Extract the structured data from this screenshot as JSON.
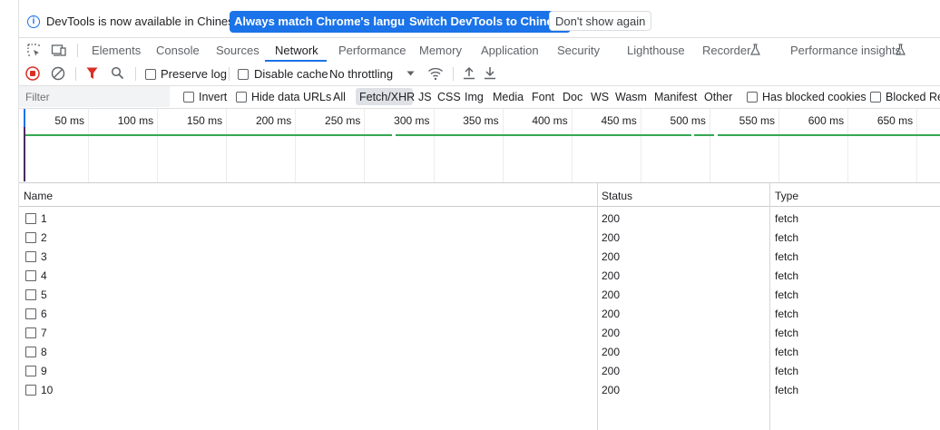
{
  "infobar": {
    "message": "DevTools is now available in Chinese!",
    "match_button": "Always match Chrome's language",
    "switch_button": "Switch DevTools to Chinese",
    "dismiss_button": "Don't show again"
  },
  "tabs": [
    "Elements",
    "Console",
    "Sources",
    "Network",
    "Performance",
    "Memory",
    "Application",
    "Security",
    "Lighthouse",
    "Recorder",
    "Performance insights"
  ],
  "active_tab": "Network",
  "toolbar": {
    "preserve_log": "Preserve log",
    "disable_cache": "Disable cache",
    "throttling": "No throttling"
  },
  "filter": {
    "placeholder": "Filter",
    "invert": "Invert",
    "hide_data_urls": "Hide data URLs",
    "types": [
      "All",
      "Fetch/XHR",
      "JS",
      "CSS",
      "Img",
      "Media",
      "Font",
      "Doc",
      "WS",
      "Wasm",
      "Manifest",
      "Other"
    ],
    "active_type": "Fetch/XHR",
    "has_blocked_cookies": "Has blocked cookies",
    "blocked_requests": "Blocked Requ"
  },
  "timeline": {
    "ticks": [
      "50 ms",
      "100 ms",
      "150 ms",
      "200 ms",
      "250 ms",
      "300 ms",
      "350 ms",
      "400 ms",
      "450 ms",
      "500 ms",
      "550 ms",
      "600 ms",
      "650 ms"
    ]
  },
  "table": {
    "columns": {
      "name": "Name",
      "status": "Status",
      "type": "Type"
    },
    "rows": [
      {
        "name": "1",
        "status": "200",
        "type": "fetch"
      },
      {
        "name": "2",
        "status": "200",
        "type": "fetch"
      },
      {
        "name": "3",
        "status": "200",
        "type": "fetch"
      },
      {
        "name": "4",
        "status": "200",
        "type": "fetch"
      },
      {
        "name": "5",
        "status": "200",
        "type": "fetch"
      },
      {
        "name": "6",
        "status": "200",
        "type": "fetch"
      },
      {
        "name": "7",
        "status": "200",
        "type": "fetch"
      },
      {
        "name": "8",
        "status": "200",
        "type": "fetch"
      },
      {
        "name": "9",
        "status": "200",
        "type": "fetch"
      },
      {
        "name": "10",
        "status": "200",
        "type": "fetch"
      }
    ]
  },
  "colors": {
    "accent": "#1a73e8",
    "record": "#d93025",
    "filter_icon": "#d93025",
    "waterfall": "#34a853"
  }
}
